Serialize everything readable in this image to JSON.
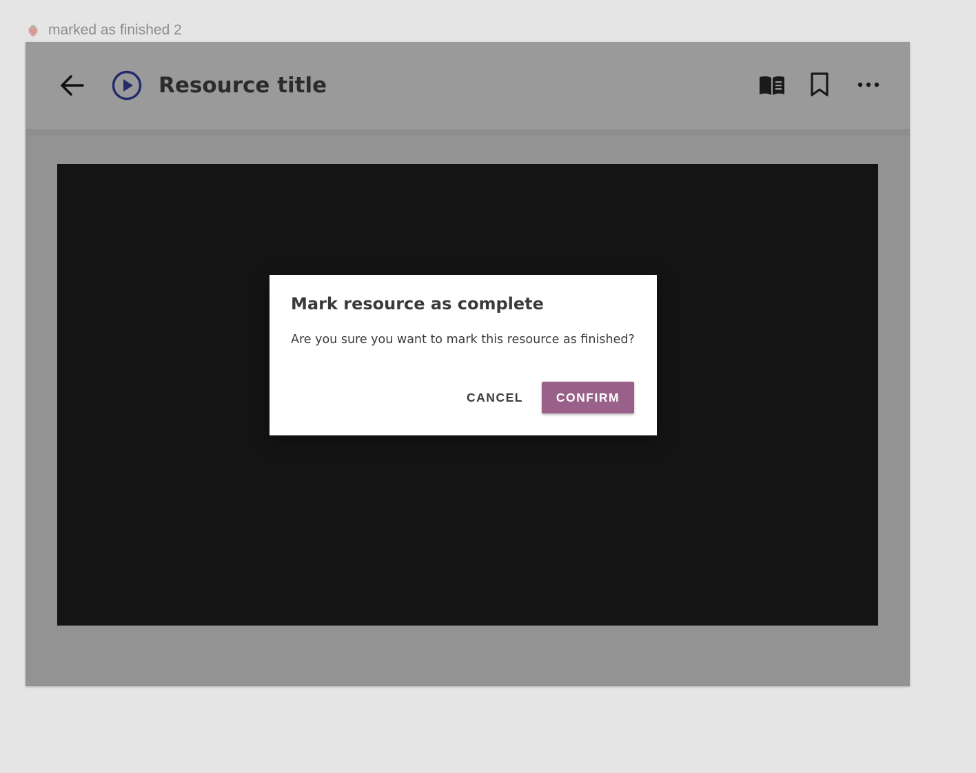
{
  "frame": {
    "label": "marked as finished 2",
    "icon": "strawberry-icon"
  },
  "appbar": {
    "title": "Resource title",
    "back_icon": "arrow-left-icon",
    "type_icon": "play-circle-icon",
    "actions": [
      {
        "icon": "book-menu-icon"
      },
      {
        "icon": "bookmark-icon"
      },
      {
        "icon": "more-horizontal-icon"
      }
    ]
  },
  "dialog": {
    "title": "Mark resource as complete",
    "body": "Are you sure you want to mark this resource as finished?",
    "cancel_label": "CANCEL",
    "confirm_label": "CONFIRM"
  },
  "colors": {
    "canvas_bg": "#e5e5e5",
    "overlay_gray": "#939393",
    "player_bg": "#141414",
    "play_icon": "#252c6a",
    "confirm_bg": "#996189",
    "text_dark": "#3a3a3a"
  }
}
